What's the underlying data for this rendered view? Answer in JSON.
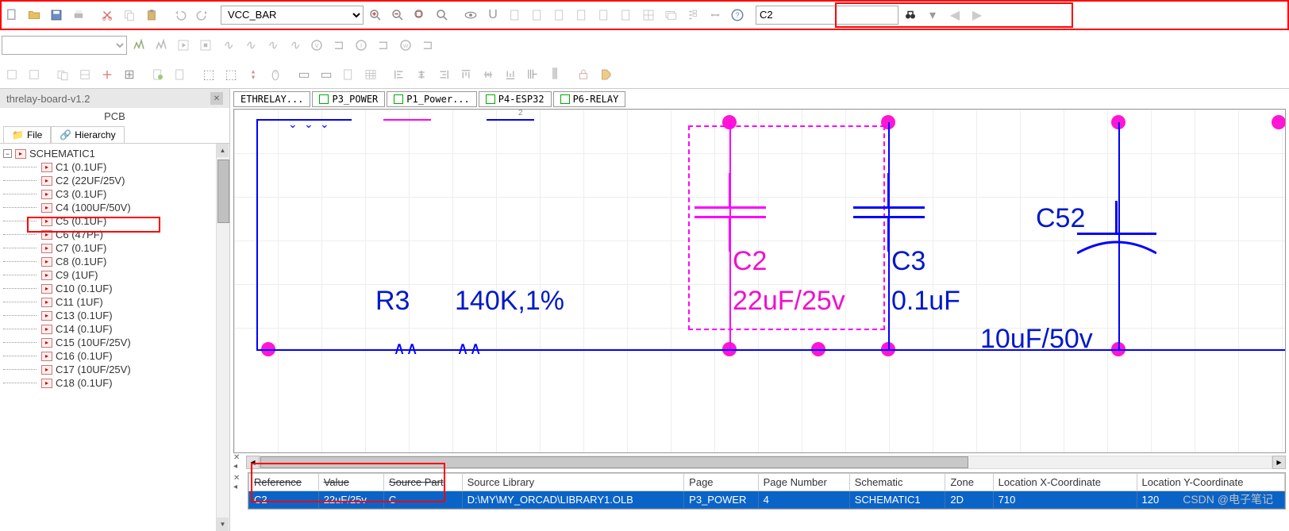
{
  "toolbar": {
    "net_combo": "VCC_BAR",
    "search_value": "C2"
  },
  "left": {
    "title": "threlay-board-v1.2",
    "sub": "PCB",
    "tabs": {
      "file": "File",
      "hierarchy": "Hierarchy"
    },
    "root": "SCHEMATIC1",
    "items": [
      "C1 (0.1UF)",
      "C2 (22UF/25V)",
      "C3 (0.1UF)",
      "C4 (100UF/50V)",
      "C5 (0.1UF)",
      "C6 (47PF)",
      "C7 (0.1UF)",
      "C8 (0.1UF)",
      "C9 (1UF)",
      "C10 (0.1UF)",
      "C11 (1UF)",
      "C13 (0.1UF)",
      "C14 (0.1UF)",
      "C15 (10UF/25V)",
      "C16 (0.1UF)",
      "C17 (10UF/25V)",
      "C18 (0.1UF)"
    ]
  },
  "doc_tabs": [
    "ETHRELAY...",
    "P3_POWER",
    "P1_Power...",
    "P4-ESP32",
    "P6-RELAY"
  ],
  "schematic": {
    "ruler": "2",
    "r3_ref": "R3",
    "r3_val": "140K,1%",
    "c2_ref": "C2",
    "c2_val": "22uF/25v",
    "c3_ref": "C3",
    "c3_val": "0.1uF",
    "c52_ref": "C52",
    "c52_val": "10uF/50v"
  },
  "props": {
    "headers": [
      "Reference",
      "Value",
      "Source Part",
      "Source Library",
      "Page",
      "Page Number",
      "Schematic",
      "Zone",
      "Location X-Coordinate",
      "Location Y-Coordinate"
    ],
    "row": [
      "C2",
      "22uF/25v",
      "C",
      "D:\\MY\\MY_ORCAD\\LIBRARY1.OLB",
      "P3_POWER",
      "4",
      "SCHEMATIC1",
      "2D",
      "710",
      "120"
    ]
  },
  "watermark": "CSDN @电子笔记"
}
